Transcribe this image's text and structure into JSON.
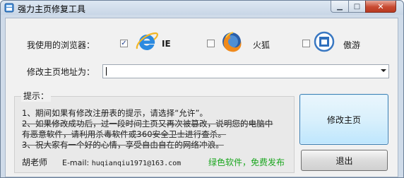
{
  "window": {
    "title": "强力主页修复工具",
    "min_symbol": "▁",
    "max_symbol": "□",
    "close_symbol": "✕"
  },
  "browser_row": {
    "label": "我使用的浏览器：",
    "options": [
      {
        "name": "IE",
        "checked": true,
        "icon": "ie-icon"
      },
      {
        "name": "火狐",
        "checked": false,
        "icon": "firefox-icon"
      },
      {
        "name": "傲游",
        "checked": false,
        "icon": "maxthon-icon"
      }
    ],
    "check_mark": "✓"
  },
  "homepage": {
    "label": "修改主页地址为：",
    "value": ""
  },
  "tips": {
    "title": "提示：",
    "line1": "1、期间如果有修改注册表的提示，请选择“允许”。",
    "line2": "2、如果修改成功后，过一段时间主页又再次被篡改，说明您的电脑中",
    "line3": "有恶意软件，请利用杀毒软件或360安全卫士进行查杀。",
    "line4": "3、祝大家有一个好的心情，享受自由自在的网络冲浪。",
    "author": "胡老师",
    "email_label": "E-mail:",
    "email": "huqianqiu1971@163.com",
    "slogan": "绿色软件，免费发布"
  },
  "buttons": {
    "modify": "修改主页",
    "exit": "退出"
  },
  "colors": {
    "window_frame": "#cfdbe9",
    "client_bg": "#f1f1f1",
    "slogan_green": "#1aa61e",
    "close_red": "#c84a31"
  }
}
